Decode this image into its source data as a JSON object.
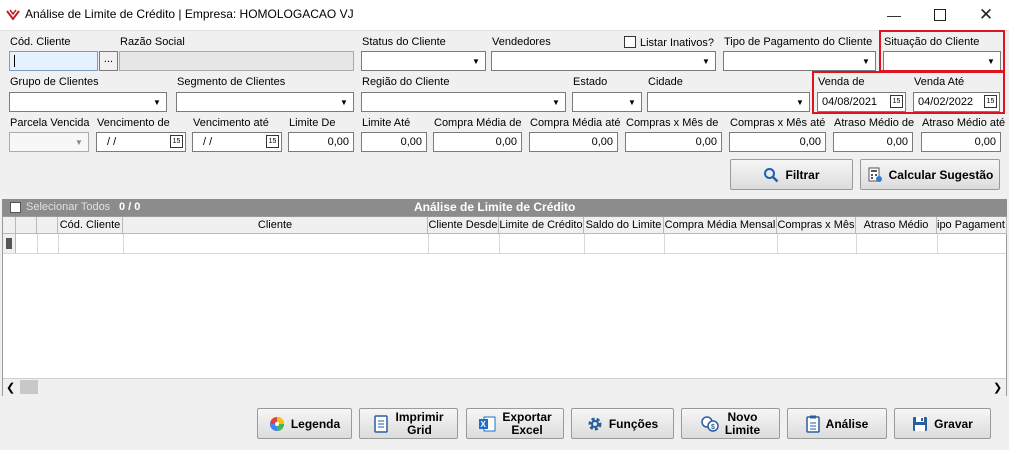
{
  "window": {
    "title": "Análise de Limite de Crédito | Empresa: HOMOLOGACAO VJ"
  },
  "labels": {
    "cod_cliente": "Cód. Cliente",
    "razao_social": "Razão Social",
    "status_cliente": "Status do Cliente",
    "vendedores": "Vendedores",
    "listar_inativos": "Listar Inativos?",
    "tipo_pagamento": "Tipo de Pagamento do Cliente",
    "situacao_cliente": "Situação do Cliente",
    "grupo_clientes": "Grupo de Clientes",
    "segmento_clientes": "Segmento de Clientes",
    "regiao_cliente": "Região do Cliente",
    "estado": "Estado",
    "cidade": "Cidade",
    "venda_de": "Venda de",
    "venda_ate": "Venda Até",
    "parcela_vencida": "Parcela Vencida",
    "vencimento_de": "Vencimento de",
    "vencimento_ate": "Vencimento até",
    "limite_de": "Limite De",
    "limite_ate": "Limite Até",
    "compra_media_de": "Compra Média de",
    "compra_media_ate": "Compra Média até",
    "compras_mes_de": "Compras x Mês de",
    "compras_mes_ate": "Compras x Mês até",
    "atraso_medio_de": "Atraso Médio de",
    "atraso_medio_ate": "Atraso Médio até"
  },
  "values": {
    "ellipsis": "...",
    "venda_de": "04/08/2021",
    "venda_ate": "04/02/2022",
    "vencimento_de": "/ /",
    "vencimento_ate": "/ /",
    "zero": "0,00",
    "cal_glyph": "15"
  },
  "buttons": {
    "filtrar": "Filtrar",
    "calcular_sugestao": "Calcular Sugestão",
    "legenda": "Legenda",
    "imprimir_1": "Imprimir",
    "imprimir_2": "Grid",
    "exportar_1": "Exportar",
    "exportar_2": "Excel",
    "funcoes": "Funções",
    "novo_1": "Novo",
    "novo_2": "Limite",
    "analise": "Análise",
    "gravar": "Gravar"
  },
  "grid": {
    "select_all": "Selecionar Todos",
    "count": "0 / 0",
    "title": "Análise de Limite de Crédito",
    "columns": [
      "Cód. Cliente",
      "Cliente",
      "Cliente Desde",
      "Limite de Crédito",
      "Saldo do Limite",
      "Compra Média Mensal",
      "Compras x Mês",
      "Atraso Médio",
      "ipo Pagament"
    ]
  }
}
